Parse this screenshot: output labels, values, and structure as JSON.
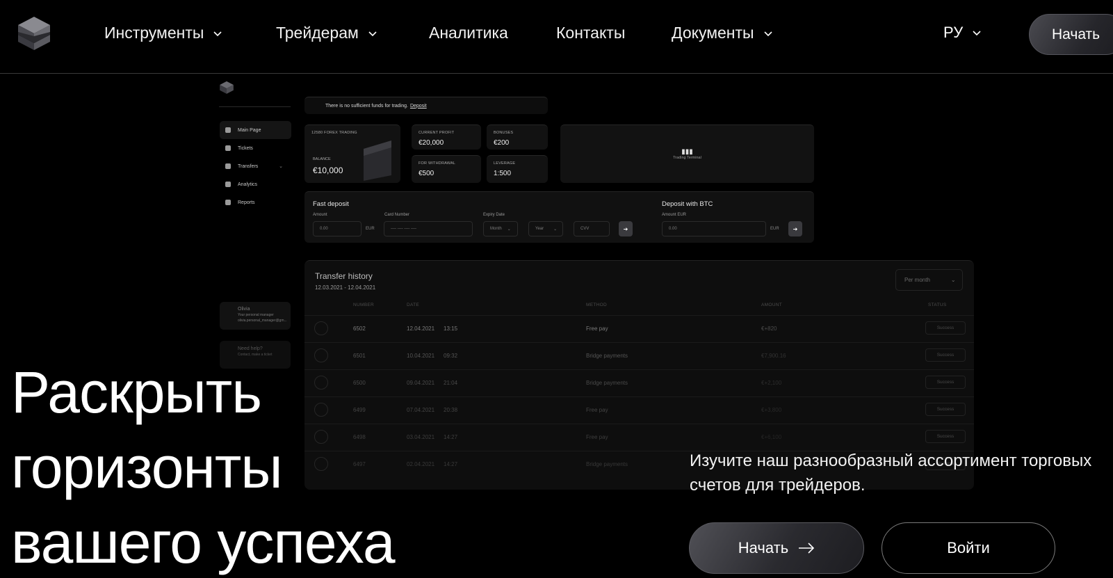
{
  "nav": {
    "items": [
      {
        "label": "Инструменты",
        "dropdown": true
      },
      {
        "label": "Трейдерам",
        "dropdown": true
      },
      {
        "label": "Аналитика",
        "dropdown": false
      },
      {
        "label": "Контакты",
        "dropdown": false
      },
      {
        "label": "Документы",
        "dropdown": true
      }
    ],
    "language": "РУ",
    "start_label": "Начать"
  },
  "dashboard": {
    "sidebar": [
      {
        "label": "Main Page",
        "icon": "home-icon"
      },
      {
        "label": "Tickets",
        "icon": "ticket-icon"
      },
      {
        "label": "Transfers",
        "icon": "transfer-icon"
      },
      {
        "label": "Analytics",
        "icon": "analytics-icon"
      },
      {
        "label": "Reports",
        "icon": "reports-icon"
      }
    ],
    "manager_name": "Olivia",
    "manager_role": "Your personal manager",
    "manager_email": "olivia.personal_manager@gm...",
    "help_title": "Need help?",
    "help_sub": "Contact, make a ticket",
    "banner_text": "There is no sufficient funds for trading.",
    "banner_link": "Deposit",
    "account_name": "12580 FOREX TRADING",
    "balance_label": "BALANCE",
    "balance_value": "€10,000",
    "current_profit_label": "CURRENT PROFIT",
    "current_profit_value": "€20,000",
    "bonuses_label": "BONUSES",
    "bonuses_value": "€200",
    "withdrawal_label": "FOR WITHDRAWAL",
    "withdrawal_value": "€500",
    "leverage_label": "LEVERAGE",
    "leverage_value": "1:500",
    "terminal_label": "Trading Terminal",
    "fast_deposit": {
      "title": "Fast deposit",
      "amount_label": "Amount",
      "amount_value": "0.00",
      "currency": "EUR",
      "card_label": "Card Number",
      "card_placeholder": "---- ---- ---- ----",
      "expiry_label": "Expiry Date",
      "month": "Month",
      "year": "Year",
      "cvv": "CVV"
    },
    "btc_deposit": {
      "title": "Deposit with BTC",
      "amount_label": "Amount EUR",
      "amount_value": "0.00",
      "currency": "EUR"
    },
    "history": {
      "title": "Transfer history",
      "range": "12.03.2021 - 12.04.2021",
      "period": "Per month",
      "columns": [
        "NUMBER",
        "DATE",
        "METHOD",
        "AMOUNT",
        "STATUS"
      ],
      "rows": [
        {
          "number": "6502",
          "date": "12.04.2021",
          "time": "13:15",
          "method": "Free pay",
          "amount": "€+820",
          "status": "Success"
        },
        {
          "number": "6501",
          "date": "10.04.2021",
          "time": "09:32",
          "method": "Bridge payments",
          "amount": "€7,900.16",
          "status": "Success"
        },
        {
          "number": "6500",
          "date": "09.04.2021",
          "time": "21:04",
          "method": "Bridge payments",
          "amount": "€+2,100",
          "status": "Success"
        },
        {
          "number": "6499",
          "date": "07.04.2021",
          "time": "20:38",
          "method": "Free pay",
          "amount": "€+3,800",
          "status": "Success"
        },
        {
          "number": "6498",
          "date": "03.04.2021",
          "time": "14:27",
          "method": "Free pay",
          "amount": "€+6,100",
          "status": "Success"
        },
        {
          "number": "6497",
          "date": "02.04.2021",
          "time": "14:27",
          "method": "Bridge payments",
          "amount": "€+3,600",
          "status": "Success"
        }
      ]
    }
  },
  "hero": {
    "line1": "Раскрыть",
    "line2": "горизонты",
    "line3": "вашего успеха",
    "description": "Изучите наш разнообразный ассортимент торговых счетов для трейдеров.",
    "start_label": "Начать",
    "login_label": "Войти"
  },
  "colors": {
    "background": "#000000",
    "text": "#ffffff",
    "button_gradient_start": "#505056",
    "button_gradient_end": "#1d1d21"
  }
}
